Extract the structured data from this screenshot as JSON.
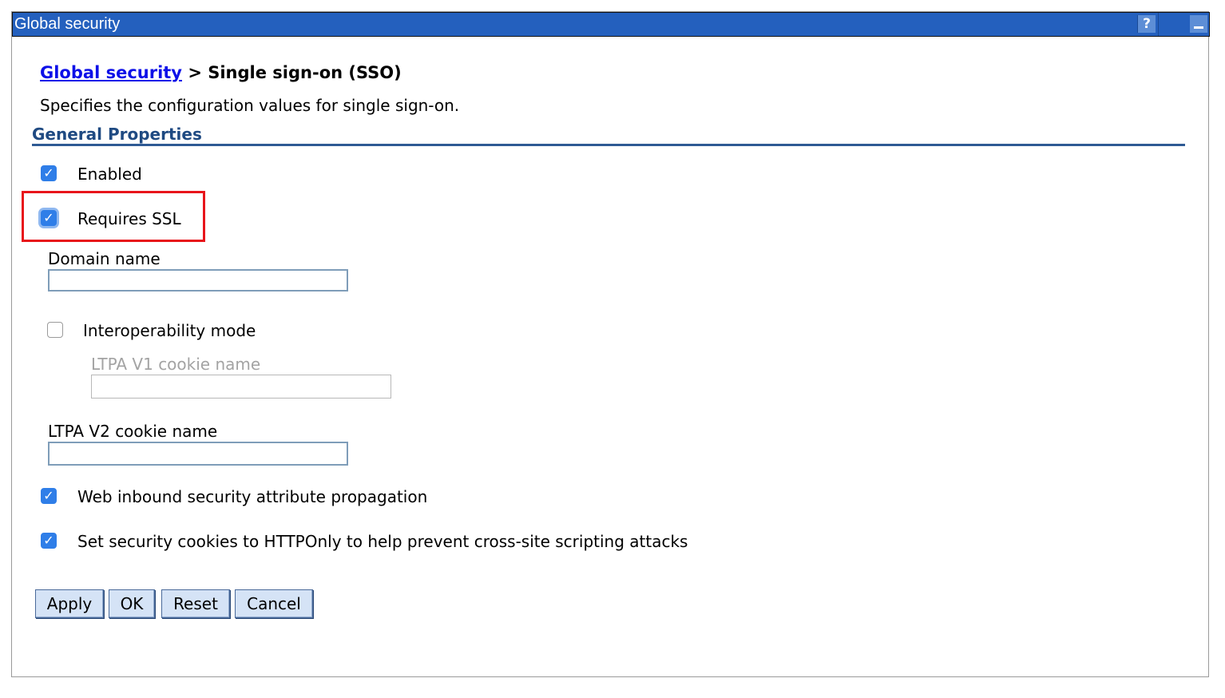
{
  "titlebar": {
    "title": "Global security",
    "help_label": "?"
  },
  "breadcrumb": {
    "link": "Global security",
    "separator": ">",
    "current": "Single sign-on (SSO)"
  },
  "description": "Specifies the configuration values for single sign-on.",
  "section_title": "General Properties",
  "fields": {
    "enabled": {
      "label": "Enabled",
      "checked": true
    },
    "requires_ssl": {
      "label": "Requires SSL",
      "checked": true
    },
    "domain_name": {
      "label": "Domain name",
      "value": ""
    },
    "interoperability_mode": {
      "label": "Interoperability mode",
      "checked": false
    },
    "ltpa_v1_cookie_name": {
      "label": "LTPA V1 cookie name",
      "value": "",
      "disabled": true
    },
    "ltpa_v2_cookie_name": {
      "label": "LTPA V2 cookie name",
      "value": ""
    },
    "web_inbound": {
      "label": "Web inbound security attribute propagation",
      "checked": true
    },
    "http_only": {
      "label": "Set security cookies to HTTPOnly to help prevent cross-site scripting attacks",
      "checked": true
    }
  },
  "buttons": {
    "apply": "Apply",
    "ok": "OK",
    "reset": "Reset",
    "cancel": "Cancel"
  },
  "colors": {
    "titlebar": "#2460be",
    "link": "#0d10e8",
    "section": "#1f4a82",
    "checkbox_checked": "#2f7ee8",
    "highlight_box": "#e8151b"
  }
}
